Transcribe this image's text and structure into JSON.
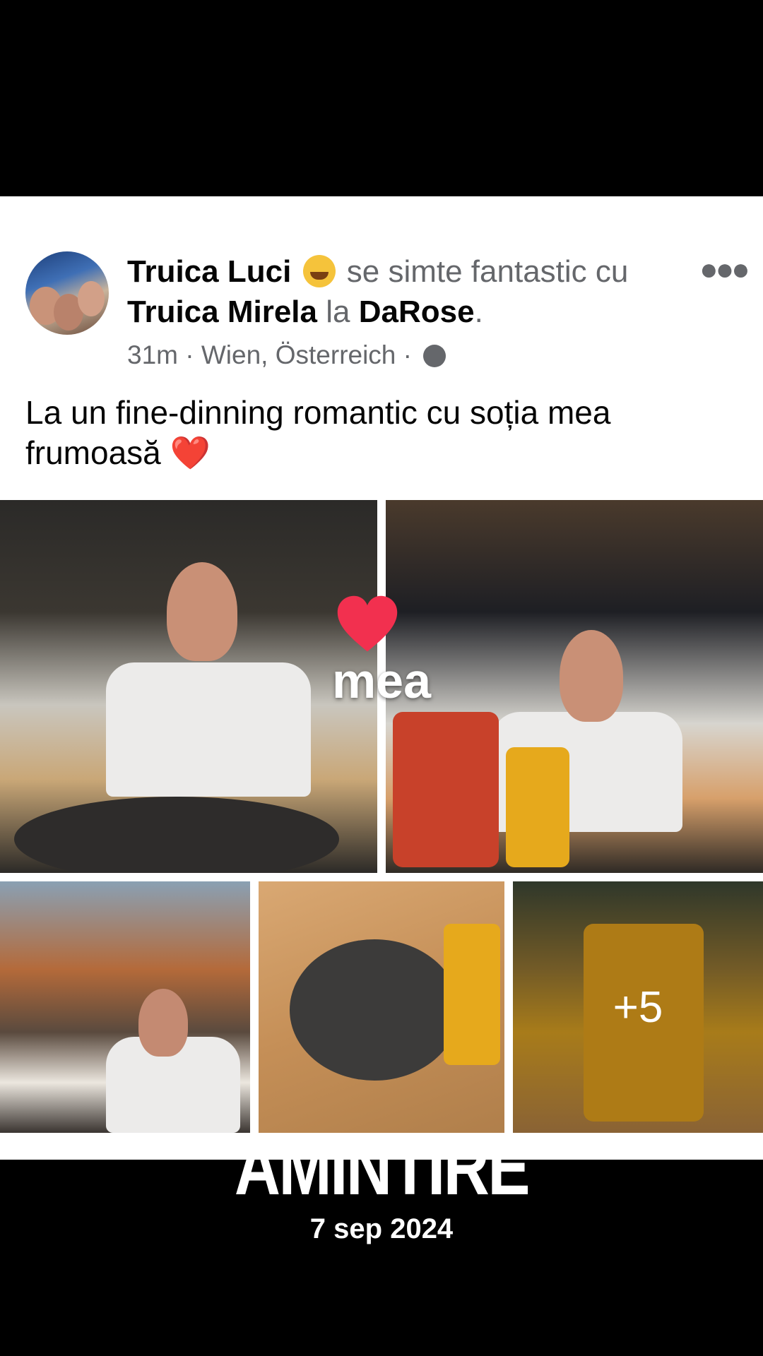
{
  "post": {
    "author": "Truica Luci",
    "feeling": "se simte fantastic cu",
    "tagged": "Truica Mirela",
    "at": "la",
    "place": "DaRose",
    "period": ".",
    "time": "31m",
    "separator": "·",
    "location": "Wien, Österreich",
    "caption": "La un fine-dinning romantic cu soția mea frumoasă",
    "caption_emoji": "❤️",
    "more_photos": "+5",
    "more_icon": "more-options-icon"
  },
  "overlay": {
    "sticker_text": "mea",
    "title": "AMINTIRE",
    "date": "7 sep 2024"
  },
  "colors": {
    "card": "#ffffff",
    "text": "#050505",
    "secondary": "#65676b",
    "heart": "#e0112b"
  }
}
